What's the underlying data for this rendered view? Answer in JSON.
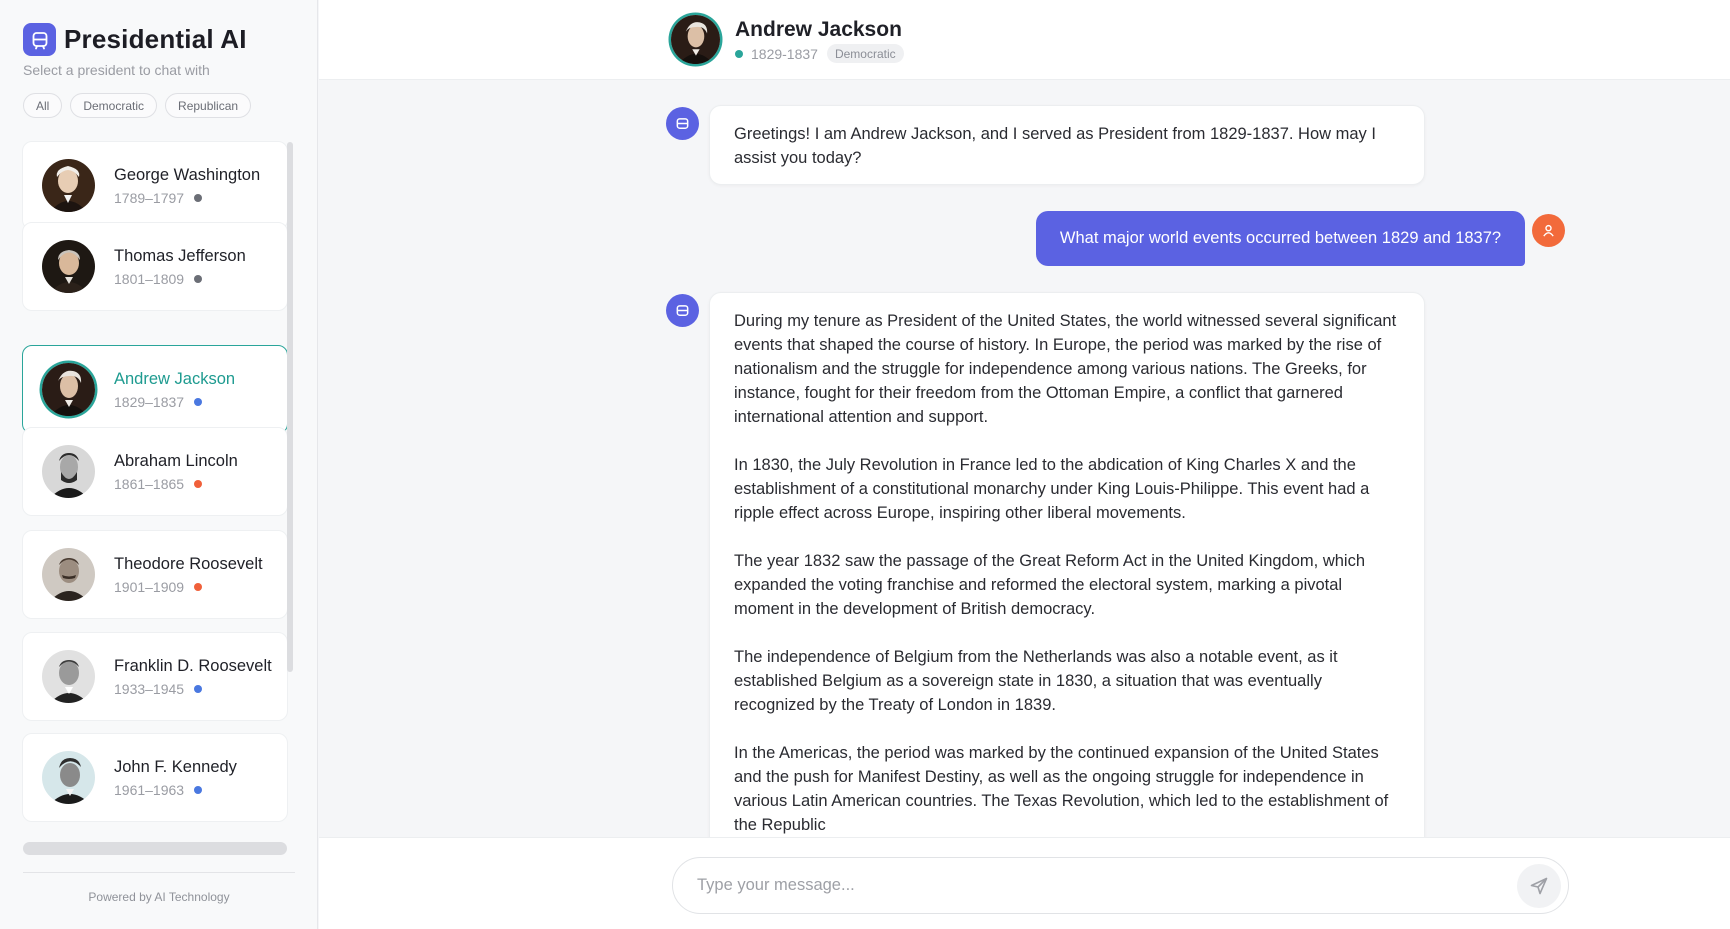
{
  "brand": {
    "title": "Presidential AI",
    "subtitle": "Select a president to chat with",
    "icon": "chat-bot-icon",
    "accent": "#5b62e2"
  },
  "filters": [
    "All",
    "Democratic",
    "Republican"
  ],
  "presidents": [
    {
      "name": "George Washington",
      "years": "1789–1797",
      "party_color": "#6b6e76"
    },
    {
      "name": "Thomas Jefferson",
      "years": "1801–1809",
      "party_color": "#6b6e76"
    },
    {
      "name": "Andrew Jackson",
      "years": "1829–1837",
      "party_color": "#4a78e0",
      "active": true
    },
    {
      "name": "Abraham Lincoln",
      "years": "1861–1865",
      "party_color": "#f0603a"
    },
    {
      "name": "Theodore Roosevelt",
      "years": "1901–1909",
      "party_color": "#f0603a"
    },
    {
      "name": "Franklin D. Roosevelt",
      "years": "1933–1945",
      "party_color": "#4a78e0"
    },
    {
      "name": "John F. Kennedy",
      "years": "1961–1963",
      "party_color": "#4a78e0"
    }
  ],
  "footer": "Powered by AI Technology",
  "header": {
    "name": "Andrew Jackson",
    "years": "1829-1837",
    "party": "Democratic",
    "status_color": "#2aa59a"
  },
  "messages": {
    "greeting": "Greetings! I am Andrew Jackson, and I served as President from 1829-1837. How may I assist you today?",
    "user_question": "What major world events occurred between 1829 and 1837?",
    "answer": [
      "During my tenure as President of the United States, the world witnessed several significant events that shaped the course of history. In Europe, the period was marked by the rise of nationalism and the struggle for independence among various nations. The Greeks, for instance, fought for their freedom from the Ottoman Empire, a conflict that garnered international attention and support.",
      "In 1830, the July Revolution in France led to the abdication of King Charles X and the establishment of a constitutional monarchy under King Louis-Philippe. This event had a ripple effect across Europe, inspiring other liberal movements.",
      "The year 1832 saw the passage of the Great Reform Act in the United Kingdom, which expanded the voting franchise and reformed the electoral system, marking a pivotal moment in the development of British democracy.",
      "The independence of Belgium from the Netherlands was also a notable event, as it established Belgium as a sovereign state in 1830, a situation that was eventually recognized by the Treaty of London in 1839.",
      "In the Americas, the period was marked by the continued expansion of the United States and the push for Manifest Destiny, as well as the ongoing struggle for independence in various Latin American countries. The Texas Revolution, which led to the establishment of the Republic"
    ]
  },
  "composer": {
    "placeholder": "Type your message...",
    "send_icon": "send-icon"
  }
}
